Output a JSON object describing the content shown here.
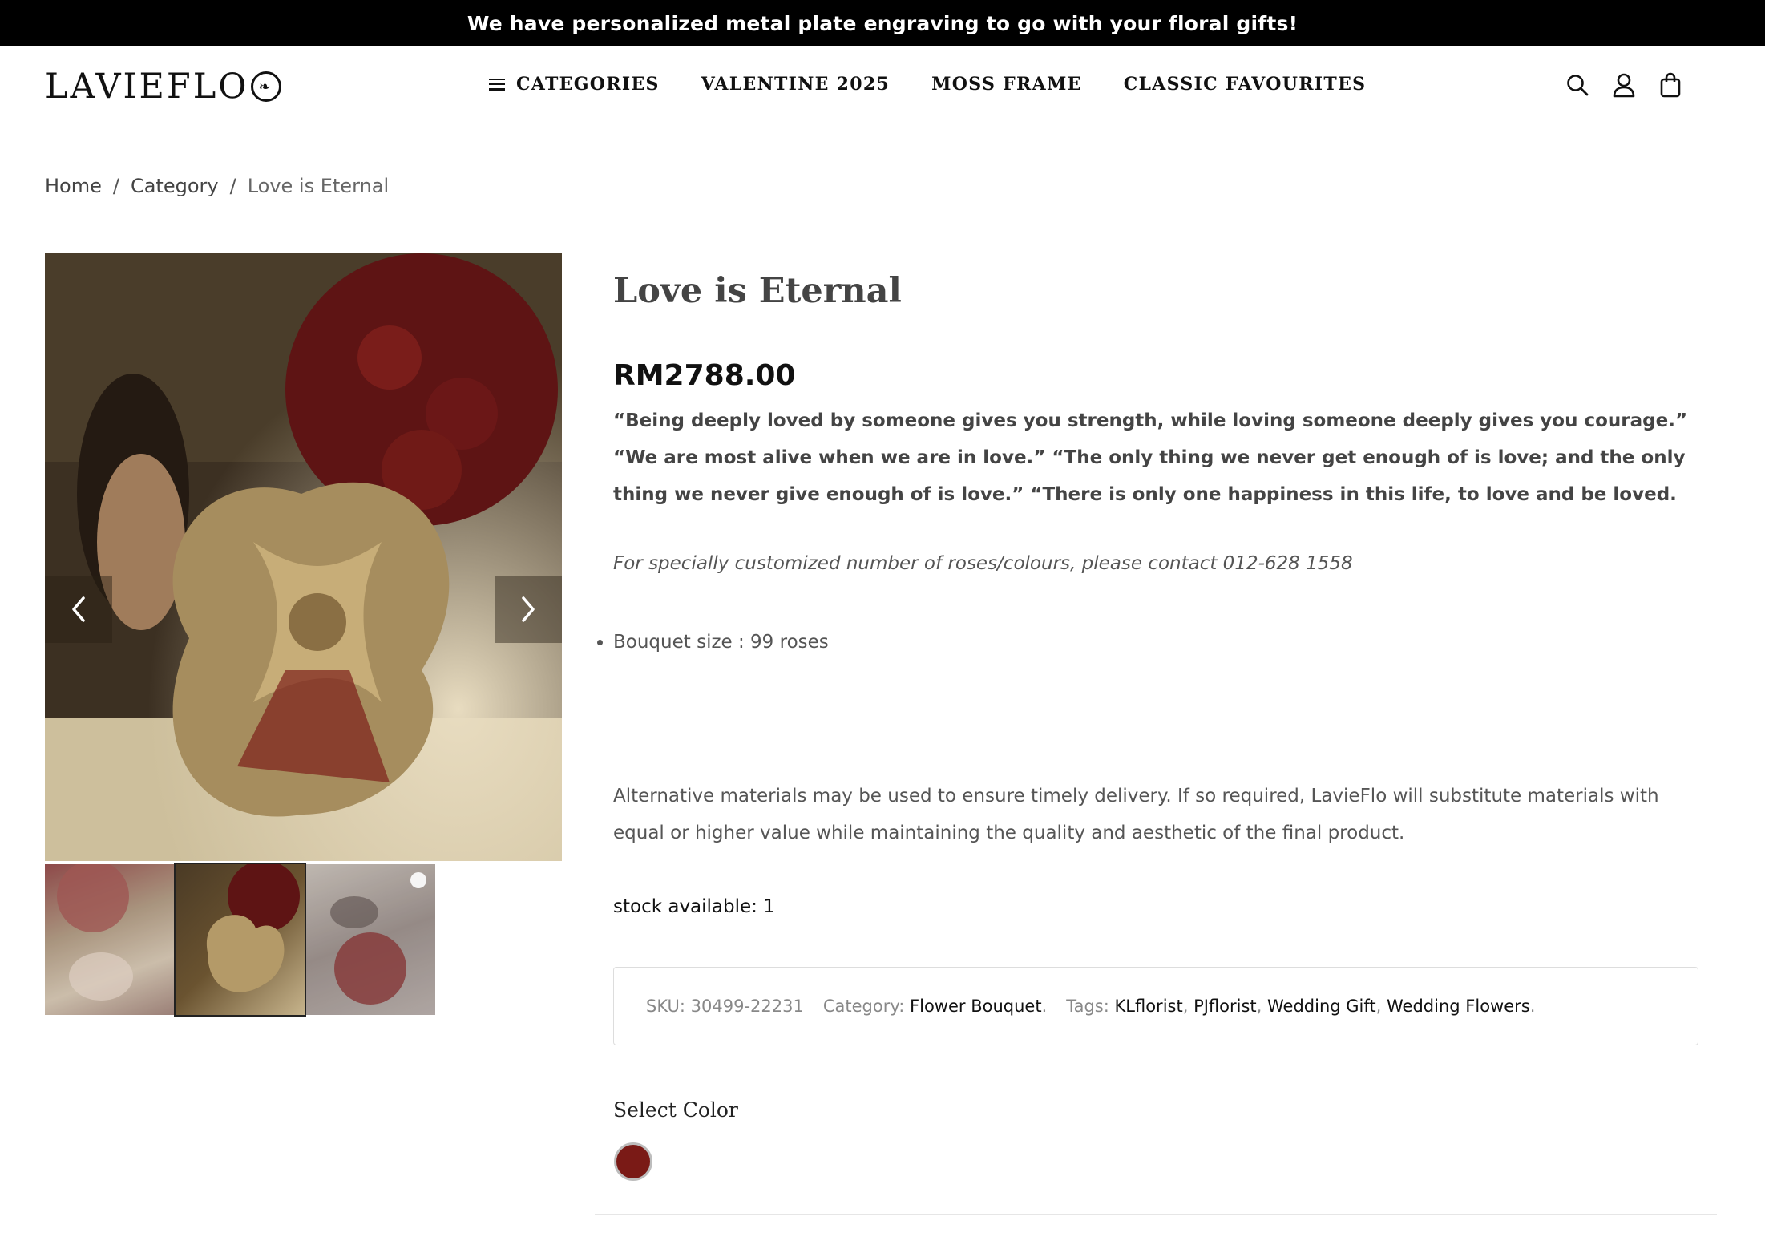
{
  "announcement": "We have personalized metal plate engraving to go with your floral gifts!",
  "logo": {
    "text": "LAVIEFLO"
  },
  "nav": [
    {
      "label": "CATEGORIES",
      "icon": "menu-icon"
    },
    {
      "label": "VALENTINE 2025"
    },
    {
      "label": "MOSS FRAME"
    },
    {
      "label": "CLASSIC FAVOURITES"
    }
  ],
  "header_icons": [
    "search-icon",
    "user-icon",
    "bag-icon"
  ],
  "breadcrumb": {
    "home": "Home",
    "sep": "/",
    "category": "Category",
    "current": "Love is Eternal"
  },
  "product": {
    "title": "Love is Eternal",
    "price": "RM2788.00",
    "quote": "“Being deeply loved by someone gives you strength, while loving someone deeply gives you courage.” “We are most alive when we are in love.” “The only thing we never get enough of is love; and the only thing we never give enough of is love.” “There is only one happiness in this life, to love and be loved.",
    "contact_note": "For specially customized number of roses/colours, please contact 012-628 1558",
    "bullets": [
      "Bouquet size : 99 roses"
    ],
    "alternative_note": "Alternative materials may be used to ensure timely delivery. If so required, LavieFlo will substitute materials with equal or higher value while maintaining the quality and aesthetic of the final product.",
    "stock": "stock available: 1",
    "meta": {
      "sku_label": "SKU:",
      "sku": "30499-22231",
      "category_label": "Category:",
      "category": "Flower Bouquet",
      "tags_label": "Tags:",
      "tags": [
        "KLflorist",
        "PJflorist",
        "Wedding Gift",
        "Wedding Flowers"
      ]
    },
    "select_color_label": "Select Color",
    "color_swatch": "#7a1a16"
  },
  "gallery": {
    "thumbnail_count": 3,
    "active_index": 1
  }
}
